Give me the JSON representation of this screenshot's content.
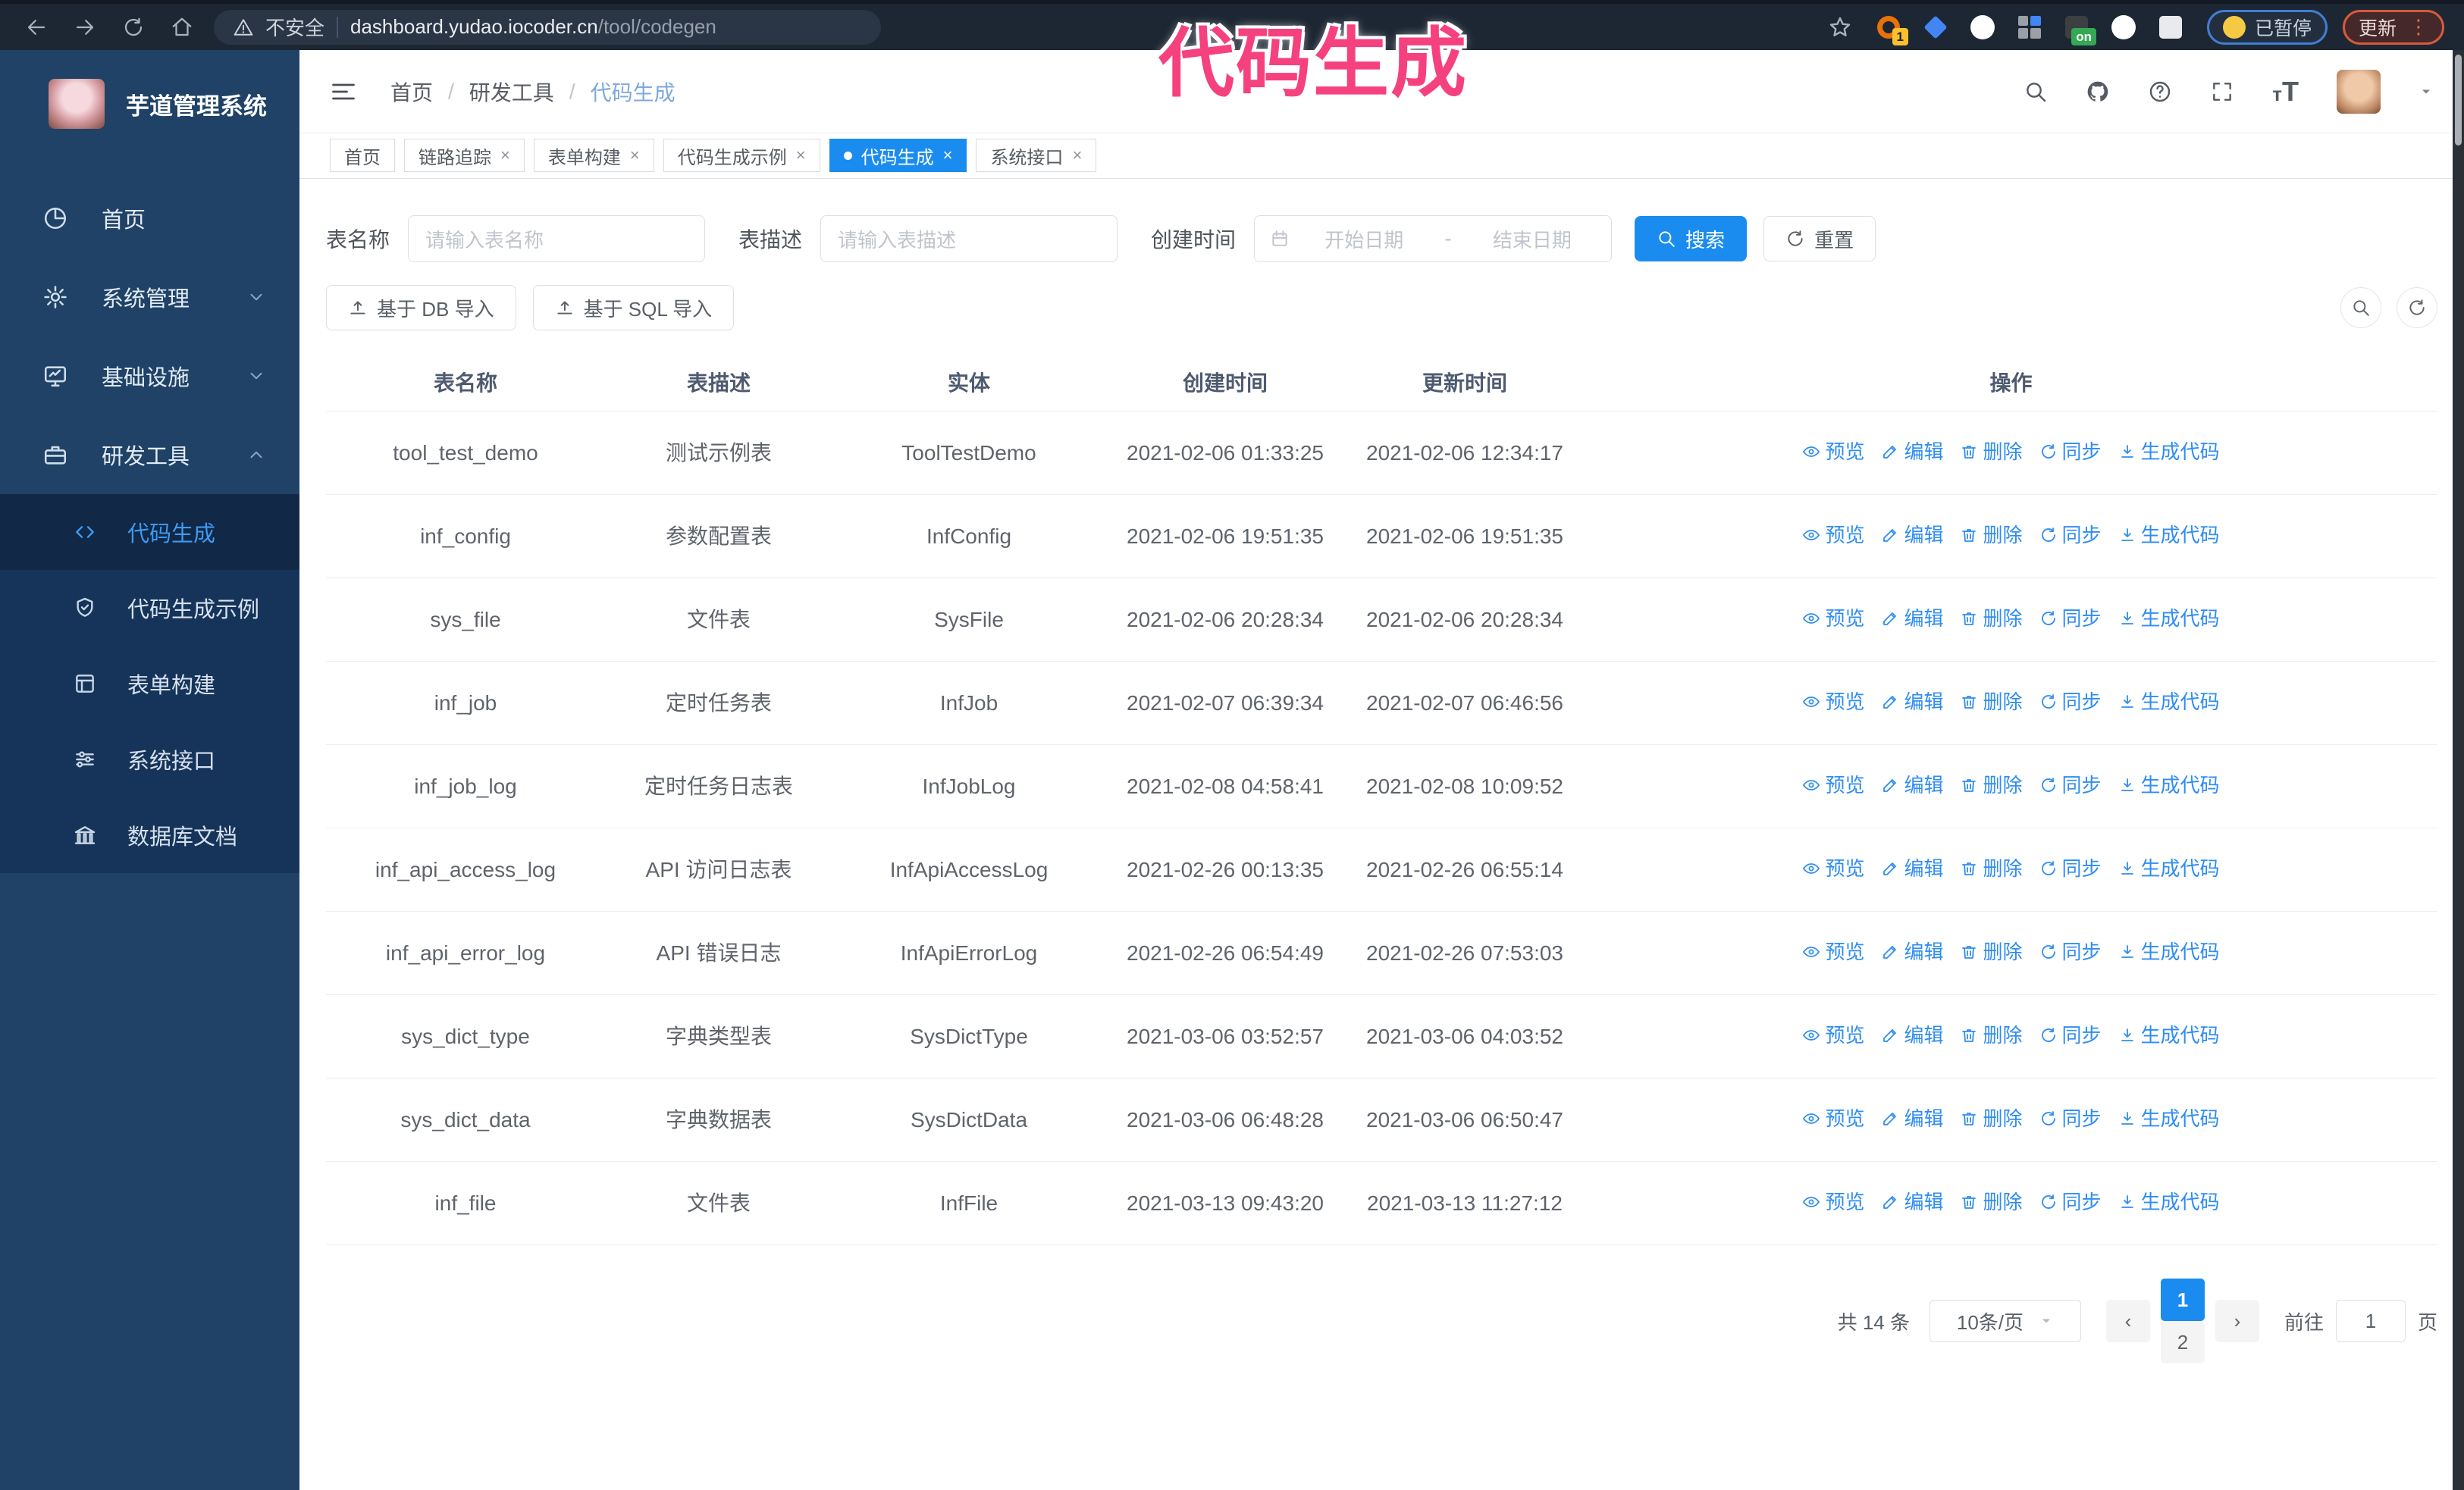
{
  "browser": {
    "security_warning": "不安全",
    "url_host": "dashboard.yudao.iocoder.cn",
    "url_path": "/tool/codegen",
    "paused_badge": "已暂停",
    "update_button": "更新",
    "extensions": [
      {
        "name": "extension-orange-ring",
        "shape": "ring",
        "color": "#e8710a",
        "badge": "1"
      },
      {
        "name": "extension-blue-diamond",
        "shape": "diamond",
        "color": "#4285f4"
      },
      {
        "name": "extension-green-check",
        "shape": "circle-check",
        "color": "#2da94f"
      },
      {
        "name": "extension-grid",
        "shape": "grid",
        "color": "#9aa0a6"
      },
      {
        "name": "extension-on-badge",
        "shape": "on-badge",
        "color": "#3c4043",
        "badge": "on"
      },
      {
        "name": "extension-green-circle",
        "shape": "circle",
        "color": "#7cb342"
      },
      {
        "name": "extension-puzzle",
        "shape": "square",
        "color": "#e8eaed"
      }
    ]
  },
  "overlay": {
    "text": "代码生成",
    "color": "#f5417d"
  },
  "sidebar": {
    "title": "芋道管理系统",
    "items": [
      {
        "label": "首页",
        "icon": "dashboard-icon",
        "chevron": ""
      },
      {
        "label": "系统管理",
        "icon": "gear-icon",
        "chevron": "down"
      },
      {
        "label": "基础设施",
        "icon": "monitor-icon",
        "chevron": "down"
      },
      {
        "label": "研发工具",
        "icon": "toolbox-icon",
        "chevron": "up"
      }
    ],
    "submenu": [
      {
        "label": "代码生成",
        "icon": "code-icon",
        "active": true
      },
      {
        "label": "代码生成示例",
        "icon": "shield-check-icon",
        "active": false
      },
      {
        "label": "表单构建",
        "icon": "form-icon",
        "active": false
      },
      {
        "label": "系统接口",
        "icon": "sliders-icon",
        "active": false
      },
      {
        "label": "数据库文档",
        "icon": "columns-icon",
        "active": false
      }
    ]
  },
  "topbar": {
    "breadcrumb": [
      "首页",
      "研发工具",
      "代码生成"
    ]
  },
  "tabs": [
    {
      "label": "首页",
      "closable": false,
      "active": false
    },
    {
      "label": "链路追踪",
      "closable": true,
      "active": false
    },
    {
      "label": "表单构建",
      "closable": true,
      "active": false
    },
    {
      "label": "代码生成示例",
      "closable": true,
      "active": false
    },
    {
      "label": "代码生成",
      "closable": true,
      "active": true
    },
    {
      "label": "系统接口",
      "closable": true,
      "active": false
    }
  ],
  "search_form": {
    "name_label": "表名称",
    "name_placeholder": "请输入表名称",
    "desc_label": "表描述",
    "desc_placeholder": "请输入表描述",
    "time_label": "创建时间",
    "start_placeholder": "开始日期",
    "separator": "-",
    "end_placeholder": "结束日期",
    "search_button": "搜索",
    "reset_button": "重置"
  },
  "toolbar": {
    "db_import": "基于 DB 导入",
    "sql_import": "基于 SQL 导入"
  },
  "table": {
    "columns": [
      "表名称",
      "表描述",
      "实体",
      "创建时间",
      "更新时间",
      "操作"
    ],
    "actions": [
      "预览",
      "编辑",
      "删除",
      "同步",
      "生成代码"
    ],
    "rows": [
      {
        "name": "tool_test_demo",
        "desc": "测试示例表",
        "entity": "ToolTestDemo",
        "created": "2021-02-06 01:33:25",
        "updated": "2021-02-06 12:34:17"
      },
      {
        "name": "inf_config",
        "desc": "参数配置表",
        "entity": "InfConfig",
        "created": "2021-02-06 19:51:35",
        "updated": "2021-02-06 19:51:35"
      },
      {
        "name": "sys_file",
        "desc": "文件表",
        "entity": "SysFile",
        "created": "2021-02-06 20:28:34",
        "updated": "2021-02-06 20:28:34"
      },
      {
        "name": "inf_job",
        "desc": "定时任务表",
        "entity": "InfJob",
        "created": "2021-02-07 06:39:34",
        "updated": "2021-02-07 06:46:56"
      },
      {
        "name": "inf_job_log",
        "desc": "定时任务日志表",
        "entity": "InfJobLog",
        "created": "2021-02-08 04:58:41",
        "updated": "2021-02-08 10:09:52"
      },
      {
        "name": "inf_api_access_log",
        "desc": "API 访问日志表",
        "entity": "InfApiAccessLog",
        "created": "2021-02-26 00:13:35",
        "updated": "2021-02-26 06:55:14"
      },
      {
        "name": "inf_api_error_log",
        "desc": "API 错误日志",
        "entity": "InfApiErrorLog",
        "created": "2021-02-26 06:54:49",
        "updated": "2021-02-26 07:53:03"
      },
      {
        "name": "sys_dict_type",
        "desc": "字典类型表",
        "entity": "SysDictType",
        "created": "2021-03-06 03:52:57",
        "updated": "2021-03-06 04:03:52"
      },
      {
        "name": "sys_dict_data",
        "desc": "字典数据表",
        "entity": "SysDictData",
        "created": "2021-03-06 06:48:28",
        "updated": "2021-03-06 06:50:47"
      },
      {
        "name": "inf_file",
        "desc": "文件表",
        "entity": "InfFile",
        "created": "2021-03-13 09:43:20",
        "updated": "2021-03-13 11:27:12"
      }
    ]
  },
  "pagination": {
    "total": "共 14 条",
    "page_size": "10条/页",
    "pages": [
      "1",
      "2"
    ],
    "active_page": "1",
    "prev": "‹",
    "next": "›",
    "goto_label": "前往",
    "goto_value": "1",
    "page_unit": "页"
  },
  "colors": {
    "accent": "#1a8cf0",
    "link": "#2f8df2",
    "sidebar_bg": "#1f4266",
    "submenu_bg": "#16345a",
    "overlay_pink": "#f5417d"
  }
}
